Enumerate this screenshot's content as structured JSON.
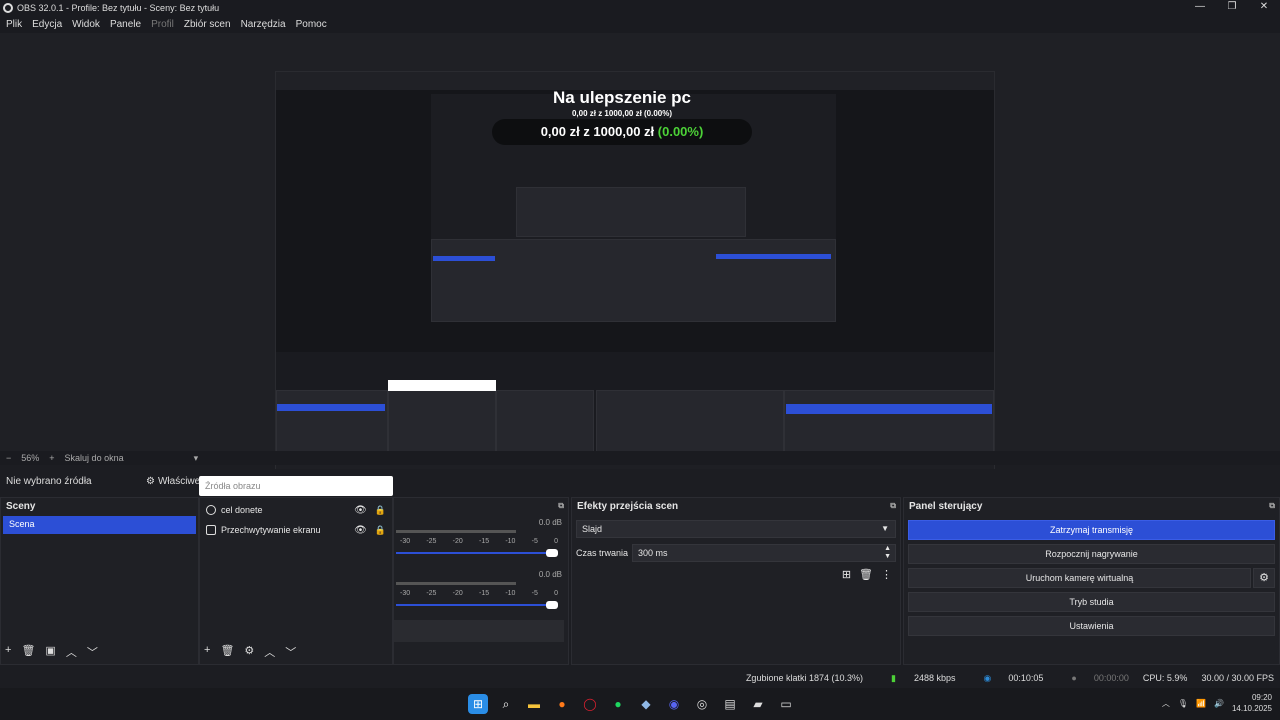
{
  "window": {
    "title": "OBS 32.0.1 - Profile: Bez tytułu - Sceny: Bez tytułu",
    "controls": [
      "—",
      "❐",
      "✕"
    ]
  },
  "menu": [
    "Plik",
    "Edycja",
    "Widok",
    "Panele",
    "Profil",
    "Zbiór scen",
    "Narzędzia",
    "Pomoc"
  ],
  "preview": {
    "goal_title": "Na ulepszenie pc",
    "goal_small": "0,00 zł z 1000,00 zł (0.00%)",
    "goal_amount": "0,00 zł z 1000,00 zł",
    "goal_percent": "(0.00%)"
  },
  "status_line": {
    "zoom": "56%",
    "scale": "Skaluj do okna"
  },
  "source_bar": {
    "no_source": "Nie wybrano źródła",
    "properties": "Właściwe"
  },
  "tooltip": "Źródła obrazu",
  "scenes": {
    "title": "Sceny",
    "items": [
      "Scena"
    ]
  },
  "sources": {
    "items": [
      "cel donete",
      "Przechwytywanie ekranu"
    ]
  },
  "mixer": {
    "channels": [
      {
        "db": "0.0 dB",
        "level": 1.0
      },
      {
        "db": "0.0 dB",
        "level": 1.0
      }
    ],
    "ticks": [
      "-30",
      "-25",
      "-20",
      "-15",
      "-10",
      "-5",
      "0"
    ]
  },
  "transitions": {
    "title": "Efekty przejścia scen",
    "selected": "Slajd",
    "duration_label": "Czas trwania",
    "duration_value": "300 ms"
  },
  "controls_panel": {
    "title": "Panel sterujący",
    "stop_stream": "Zatrzymaj transmisję",
    "start_record": "Rozpocznij nagrywanie",
    "virtual_cam": "Uruchom kamerę wirtualną",
    "studio_mode": "Tryb studia",
    "settings": "Ustawienia"
  },
  "stats": {
    "dropped": "Zgubione klatki 1874 (10.3%)",
    "bitrate": "2488 kbps",
    "stream_time": "00:10:05",
    "rec_time": "00:00:00",
    "cpu": "CPU: 5.9%",
    "fps": "30.00 / 30.00 FPS"
  },
  "clock": {
    "time": "09:20",
    "date": "14.10.2025"
  },
  "colors": {
    "accent": "#2c4fd6",
    "green": "#4cd137"
  }
}
